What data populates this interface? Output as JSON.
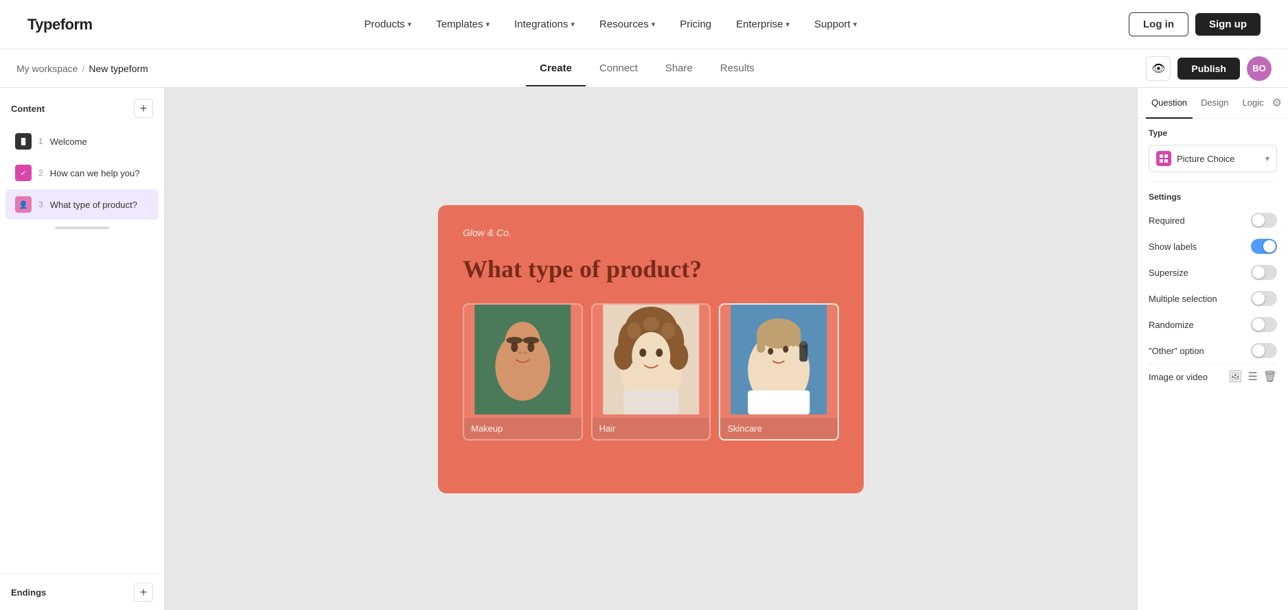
{
  "nav": {
    "logo": "Typeform",
    "links": [
      {
        "label": "Products",
        "has_dropdown": true
      },
      {
        "label": "Templates",
        "has_dropdown": true
      },
      {
        "label": "Integrations",
        "has_dropdown": true
      },
      {
        "label": "Resources",
        "has_dropdown": true
      },
      {
        "label": "Pricing",
        "has_dropdown": false
      },
      {
        "label": "Enterprise",
        "has_dropdown": true
      },
      {
        "label": "Support",
        "has_dropdown": true
      }
    ],
    "login_label": "Log in",
    "signup_label": "Sign up"
  },
  "topbar": {
    "breadcrumb_workspace": "My workspace",
    "breadcrumb_sep": "/",
    "breadcrumb_form": "New typeform",
    "tabs": [
      "Create",
      "Connect",
      "Share",
      "Results"
    ],
    "active_tab": "Create",
    "publish_label": "Publish",
    "avatar_initials": "BO"
  },
  "sidebar": {
    "content_label": "Content",
    "questions": [
      {
        "num": "1",
        "label": "Welcome",
        "type": "welcome"
      },
      {
        "num": "2",
        "label": "How can we help you?",
        "type": "check"
      },
      {
        "num": "3",
        "label": "What type of product?",
        "type": "person",
        "active": true
      }
    ],
    "endings_label": "Endings"
  },
  "canvas": {
    "brand": "Glow & Co.",
    "question": "What type of product?",
    "choices": [
      {
        "label": "Makeup",
        "emoji": "👩"
      },
      {
        "label": "Hair",
        "emoji": "👩‍🦱"
      },
      {
        "label": "Skincare",
        "emoji": "🧴"
      }
    ]
  },
  "panel": {
    "tabs": [
      "Question",
      "Design",
      "Logic"
    ],
    "active_tab": "Question",
    "type_label": "Type",
    "type_value": "Picture Choice",
    "settings_label": "Settings",
    "settings": [
      {
        "label": "Required",
        "on": false
      },
      {
        "label": "Show labels",
        "on": true
      },
      {
        "label": "Supersize",
        "on": false
      },
      {
        "label": "Multiple selection",
        "on": false
      },
      {
        "label": "Randomize",
        "on": false
      },
      {
        "label": "\"Other\" option",
        "on": false
      }
    ],
    "image_video_label": "Image or video"
  }
}
